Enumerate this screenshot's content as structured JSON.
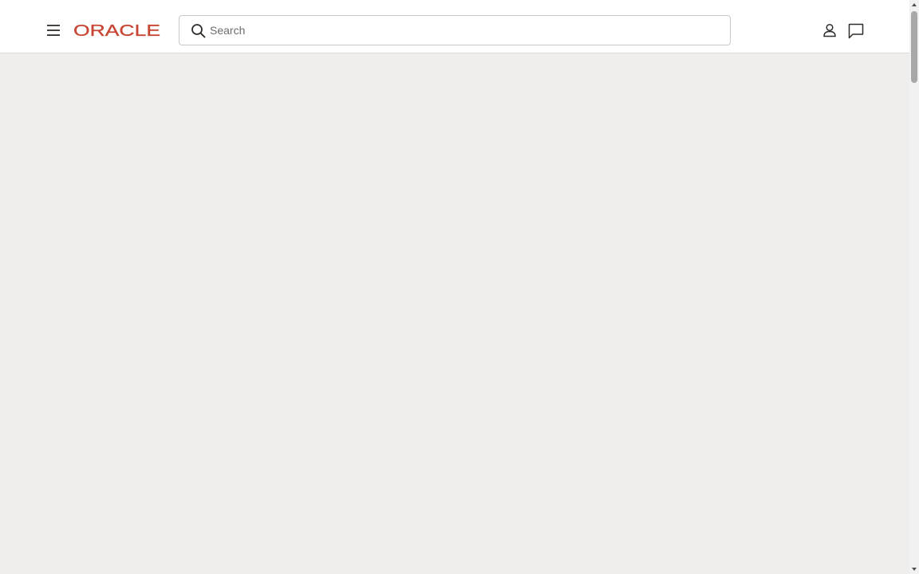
{
  "header": {
    "logo_text": "ORACLE",
    "search": {
      "placeholder": "Search",
      "value": ""
    }
  },
  "colors": {
    "brand": "#c74634",
    "content_background": "#efeeec",
    "header_background": "#ffffff",
    "icon": "#312d2a"
  },
  "icons": [
    "menu-icon",
    "search-icon",
    "account-icon",
    "chat-icon"
  ]
}
